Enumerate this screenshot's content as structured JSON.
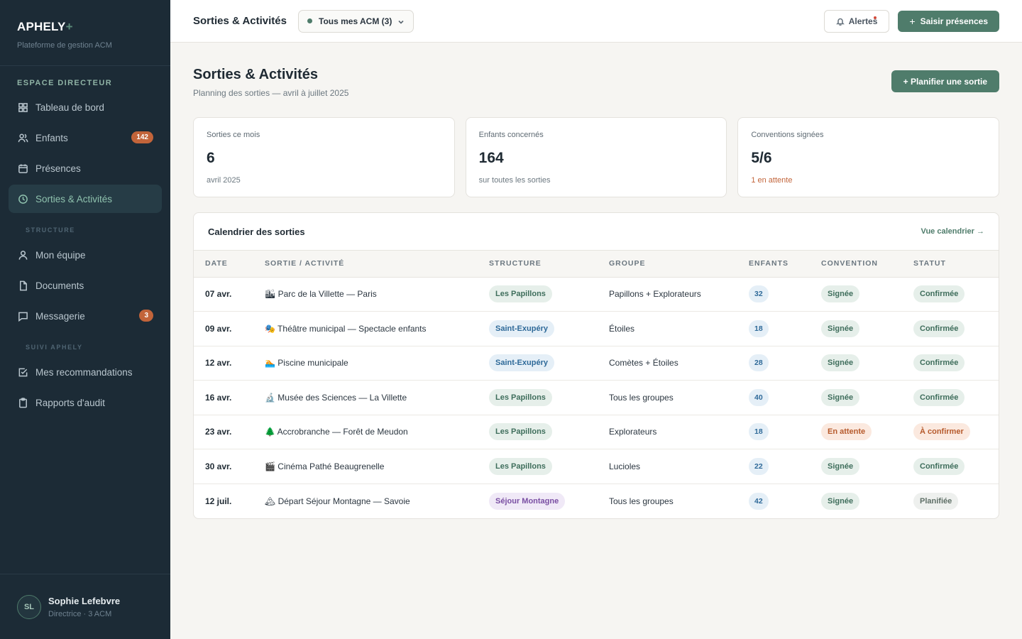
{
  "brand": {
    "name": "APHELY",
    "plus": "+",
    "subtitle": "Plateforme de gestion ACM"
  },
  "sidebar": {
    "section_title": "ESPACE DIRECTEUR",
    "items": [
      {
        "label": "Tableau de bord",
        "icon": "grid-icon"
      },
      {
        "label": "Enfants",
        "icon": "users-icon",
        "badge": "142"
      },
      {
        "label": "Présences",
        "icon": "calendar-icon"
      },
      {
        "label": "Sorties & Activités",
        "icon": "clock-icon",
        "active": true
      }
    ],
    "structure_title": "STRUCTURE",
    "structure_items": [
      {
        "label": "Mon équipe",
        "icon": "user-icon"
      },
      {
        "label": "Documents",
        "icon": "file-icon"
      },
      {
        "label": "Messagerie",
        "icon": "message-icon",
        "badge": "3"
      }
    ],
    "suivi_title": "SUIVI APHELY",
    "suivi_items": [
      {
        "label": "Mes recommandations",
        "icon": "check-square-icon"
      },
      {
        "label": "Rapports d'audit",
        "icon": "clipboard-icon"
      }
    ],
    "user": {
      "initials": "SL",
      "name": "Sophie Lefebvre",
      "role": "Directrice · 3 ACM"
    }
  },
  "topbar": {
    "title": "Sorties & Activités",
    "acm_select": "Tous mes ACM (3)",
    "alerts_label": "Alertes",
    "primary_label": "Saisir présences",
    "primary_plus": "+"
  },
  "page": {
    "title": "Sorties & Activités",
    "subtitle": "Planning des sorties — avril à juillet 2025",
    "plan_button": "+ Planifier une sortie"
  },
  "stats": [
    {
      "label": "Sorties ce mois",
      "value": "6",
      "note": "avril 2025"
    },
    {
      "label": "Enfants concernés",
      "value": "164",
      "note": "sur toutes les sorties"
    },
    {
      "label": "Conventions signées",
      "value": "5/6",
      "note": "1 en attente"
    }
  ],
  "table": {
    "title": "Calendrier des sorties",
    "link": "Vue calendrier →",
    "columns": [
      "DATE",
      "SORTIE / ACTIVITÉ",
      "STRUCTURE",
      "GROUPE",
      "ENFANTS",
      "CONVENTION",
      "STATUT"
    ],
    "rows": [
      {
        "date": "07 avr.",
        "activity": "🏙 Parc de la Villette — Paris",
        "structure": "Les Papillons",
        "group": "Papillons + Explorateurs",
        "children": "32",
        "convention": "Signée",
        "status": "Confirmée"
      },
      {
        "date": "09 avr.",
        "activity": "🎭 Théâtre municipal — Spectacle enfants",
        "structure": "Saint-Exupéry",
        "group": "Étoiles",
        "children": "18",
        "convention": "Signée",
        "status": "Confirmée"
      },
      {
        "date": "12 avr.",
        "activity": "🏊 Piscine municipale",
        "structure": "Saint-Exupéry",
        "group": "Comètes + Étoiles",
        "children": "28",
        "convention": "Signée",
        "status": "Confirmée"
      },
      {
        "date": "16 avr.",
        "activity": "🔬 Musée des Sciences — La Villette",
        "structure": "Les Papillons",
        "group": "Tous les groupes",
        "children": "40",
        "convention": "Signée",
        "status": "Confirmée"
      },
      {
        "date": "23 avr.",
        "activity": "🌲 Accrobranche — Forêt de Meudon",
        "structure": "Les Papillons",
        "group": "Explorateurs",
        "children": "18",
        "convention": "En attente",
        "status": "À confirmer"
      },
      {
        "date": "30 avr.",
        "activity": "🎬 Cinéma Pathé Beaugrenelle",
        "structure": "Les Papillons",
        "group": "Lucioles",
        "children": "22",
        "convention": "Signée",
        "status": "Confirmée"
      },
      {
        "date": "12 juil.",
        "activity": "🏔 Départ Séjour Montagne — Savoie",
        "structure": "Séjour Montagne",
        "group": "Tous les groupes",
        "children": "42",
        "convention": "Signée",
        "status": "Planifiée"
      }
    ]
  },
  "colors": {
    "accent": "#4f7c6b",
    "sidebar": "#1c2b36",
    "badge": "#c2643a"
  }
}
